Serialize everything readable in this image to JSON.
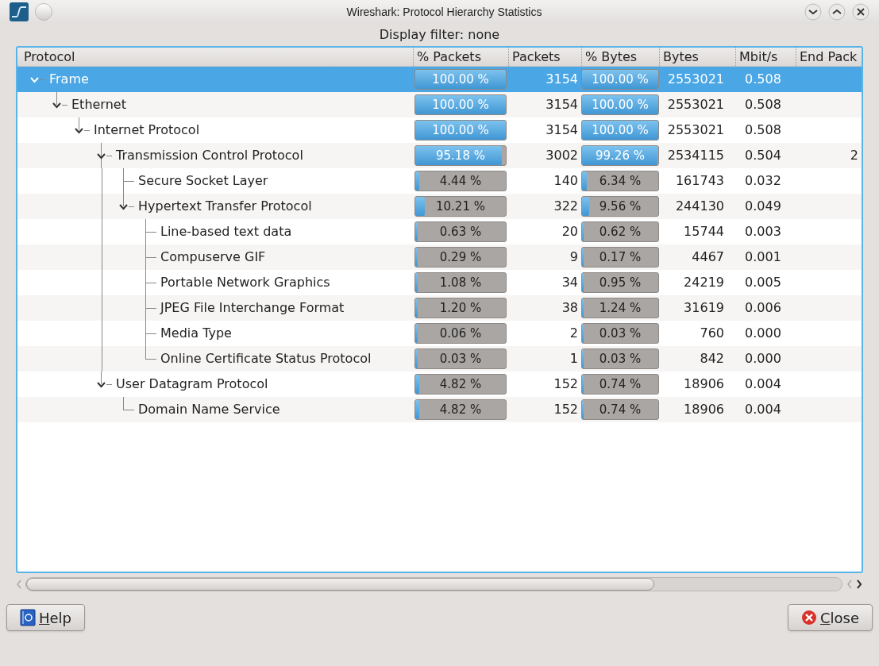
{
  "window": {
    "title": "Wireshark: Protocol Hierarchy Statistics"
  },
  "display_filter": "Display filter: none",
  "table": {
    "columns": [
      "Protocol",
      "% Packets",
      "Packets",
      "% Bytes",
      "Bytes",
      "Mbit/s",
      "End Pack"
    ],
    "rows": [
      {
        "name": "Frame",
        "selected": true,
        "expanded": true,
        "pct_packets": {
          "text": "100.00 %",
          "level": 1
        },
        "packets": "3154",
        "pct_bytes": {
          "text": "100.00 %",
          "level": 1
        },
        "bytes": "2553021",
        "mbits": "0.508",
        "children": [
          {
            "name": "Ethernet",
            "selected": false,
            "expanded": true,
            "pct_packets": {
              "text": "100.00 %",
              "level": 1
            },
            "packets": "3154",
            "pct_bytes": {
              "text": "100.00 %",
              "level": 1
            },
            "bytes": "2553021",
            "mbits": "0.508",
            "children": [
              {
                "name": "Internet Protocol",
                "selected": false,
                "expanded": true,
                "pct_packets": {
                  "text": "100.00 %",
                  "level": 1
                },
                "packets": "3154",
                "pct_bytes": {
                  "text": "100.00 %",
                  "level": 1
                },
                "bytes": "2553021",
                "mbits": "0.508",
                "children": [
                  {
                    "name": "Transmission Control Protocol",
                    "selected": false,
                    "expanded": true,
                    "pct_packets": {
                      "text": "95.18 %",
                      "level": 0.9518
                    },
                    "packets": "3002",
                    "pct_bytes": {
                      "text": "99.26 %",
                      "level": 0.9926
                    },
                    "bytes": "2534115",
                    "mbits": "0.504",
                    "end_packets": "2",
                    "children": [
                      {
                        "name": "Secure Socket Layer",
                        "selected": false,
                        "pct_packets": {
                          "text": "4.44 %",
                          "level": 0.0444
                        },
                        "packets": "140",
                        "pct_bytes": {
                          "text": "6.34 %",
                          "level": 0.0634
                        },
                        "bytes": "161743",
                        "mbits": "0.032"
                      },
                      {
                        "name": "Hypertext Transfer Protocol",
                        "selected": false,
                        "expanded": true,
                        "pct_packets": {
                          "text": "10.21 %",
                          "level": 0.1021
                        },
                        "packets": "322",
                        "pct_bytes": {
                          "text": "9.56 %",
                          "level": 0.0956
                        },
                        "bytes": "244130",
                        "mbits": "0.049",
                        "children": [
                          {
                            "name": "Line-based text data",
                            "selected": false,
                            "pct_packets": {
                              "text": "0.63 %",
                              "level": 0.0063
                            },
                            "packets": "20",
                            "pct_bytes": {
                              "text": "0.62 %",
                              "level": 0.0062
                            },
                            "bytes": "15744",
                            "mbits": "0.003"
                          },
                          {
                            "name": "Compuserve GIF",
                            "selected": false,
                            "pct_packets": {
                              "text": "0.29 %",
                              "level": 0.0029
                            },
                            "packets": "9",
                            "pct_bytes": {
                              "text": "0.17 %",
                              "level": 0.0017
                            },
                            "bytes": "4467",
                            "mbits": "0.001"
                          },
                          {
                            "name": "Portable Network Graphics",
                            "selected": false,
                            "pct_packets": {
                              "text": "1.08 %",
                              "level": 0.0108
                            },
                            "packets": "34",
                            "pct_bytes": {
                              "text": "0.95 %",
                              "level": 0.0095
                            },
                            "bytes": "24219",
                            "mbits": "0.005"
                          },
                          {
                            "name": "JPEG File Interchange Format",
                            "selected": false,
                            "pct_packets": {
                              "text": "1.20 %",
                              "level": 0.012
                            },
                            "packets": "38",
                            "pct_bytes": {
                              "text": "1.24 %",
                              "level": 0.0124
                            },
                            "bytes": "31619",
                            "mbits": "0.006"
                          },
                          {
                            "name": "Media Type",
                            "selected": false,
                            "pct_packets": {
                              "text": "0.06 %",
                              "level": 0.0006
                            },
                            "packets": "2",
                            "pct_bytes": {
                              "text": "0.03 %",
                              "level": 0.0003
                            },
                            "bytes": "760",
                            "mbits": "0.000"
                          },
                          {
                            "name": "Online Certificate Status Protocol",
                            "selected": false,
                            "pct_packets": {
                              "text": "0.03 %",
                              "level": 0.0003
                            },
                            "packets": "1",
                            "pct_bytes": {
                              "text": "0.03 %",
                              "level": 0.0003
                            },
                            "bytes": "842",
                            "mbits": "0.000"
                          }
                        ]
                      }
                    ]
                  },
                  {
                    "name": "User Datagram Protocol",
                    "selected": false,
                    "expanded": true,
                    "pct_packets": {
                      "text": "4.82 %",
                      "level": 0.0482
                    },
                    "packets": "152",
                    "pct_bytes": {
                      "text": "0.74 %",
                      "level": 0.0074
                    },
                    "bytes": "18906",
                    "mbits": "0.004",
                    "children": [
                      {
                        "name": "Domain Name Service",
                        "selected": false,
                        "pct_packets": {
                          "text": "4.82 %",
                          "level": 0.0482
                        },
                        "packets": "152",
                        "pct_bytes": {
                          "text": "0.74 %",
                          "level": 0.0074
                        },
                        "bytes": "18906",
                        "mbits": "0.004"
                      }
                    ]
                  }
                ]
              }
            ]
          }
        ]
      }
    ]
  },
  "buttons": [
    {
      "label": "Help",
      "kind": "help"
    },
    {
      "label": "Close",
      "kind": "close"
    }
  ]
}
